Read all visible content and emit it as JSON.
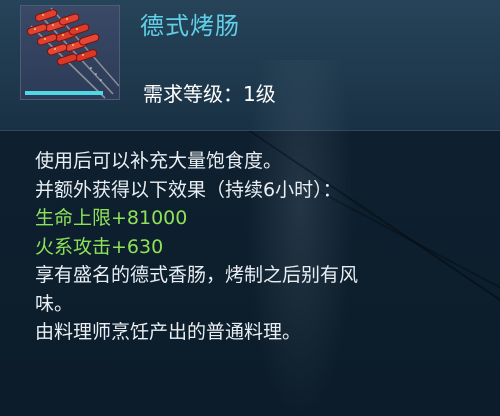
{
  "item": {
    "name": "德式烤肠",
    "icon": "grilled-sausage-skewers-icon",
    "required_level": "需求等级：1级"
  },
  "description": {
    "line1": "使用后可以补充大量饱食度。",
    "line2": "并额外获得以下效果（持续6小时）：",
    "bonus_hp": "生命上限+81000",
    "bonus_fire": "火系攻击+630",
    "flavor1": "享有盛名的德式香肠，烤制之后别有风",
    "flavor2": "味。",
    "source": "由料理师烹饪产出的普通料理。"
  },
  "colors": {
    "name": "#5fd0e8",
    "bonus": "#8ee25a",
    "text": "#e8eef2",
    "icon_accent": "#4fd7e6"
  }
}
